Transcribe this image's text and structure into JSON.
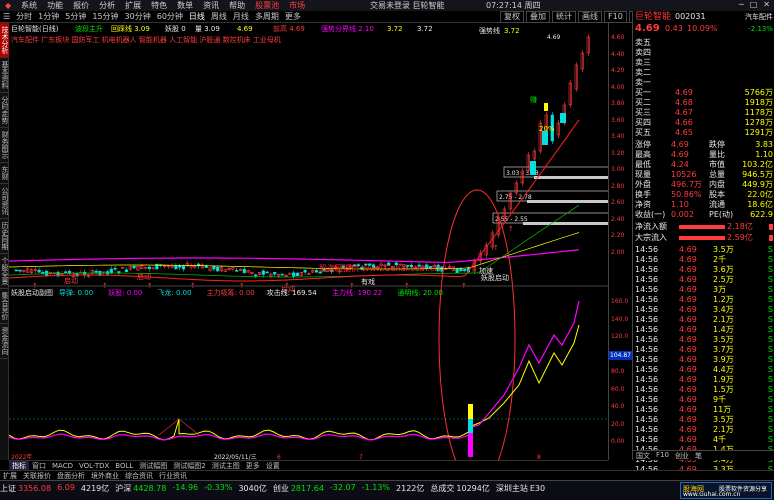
{
  "menubar": {
    "items": [
      "系统",
      "功能",
      "报价",
      "分析",
      "扩展",
      "特色",
      "数单",
      "资讯",
      "帮助"
    ],
    "highlight": [
      "股票池",
      "市场"
    ],
    "center": "交易未登录  巨轮智能",
    "time": "07:27:14 周四"
  },
  "toolbar": {
    "periods": [
      "分时",
      "1分钟",
      "5分钟",
      "15分钟",
      "30分钟",
      "60分钟",
      "日线",
      "周线",
      "月线",
      "多周期",
      "更多"
    ],
    "selected": "日线",
    "right": [
      "复权",
      "叠加",
      "统计",
      "画线",
      "F10",
      "标记",
      "自选"
    ]
  },
  "sidebar": {
    "items": [
      "技术分析",
      "基本资料",
      "分时走势",
      "财务图示",
      "东财",
      "公司资讯",
      "历史同期",
      "个股全景",
      "集合竞价",
      "资金流向"
    ],
    "active": "技术分析"
  },
  "chart": {
    "header_left": "巨轮智能(日线)",
    "header_fields": [
      {
        "label": "波段主升",
        "value": "",
        "color": "#00e000"
      },
      {
        "label": "回踩线",
        "value": "3.09",
        "color": "#ffff00"
      },
      {
        "label": "妖股",
        "value": "0",
        "color": "#e8e8e8"
      },
      {
        "label": "量",
        "value": "3.09",
        "color": "#e8e8e8"
      },
      {
        "label": "4.69",
        "value": "",
        "color": "#ffff00"
      },
      {
        "label": "前高",
        "value": "4.69",
        "color": "#ff3c3c"
      },
      {
        "label": "强势分界线",
        "value": "2.10",
        "color": "#ff00ff"
      },
      {
        "label": "",
        "value": "3.72",
        "color": "#ffff00"
      },
      {
        "label": "",
        "value": "3.72",
        "color": "#e8e8e8"
      }
    ],
    "concept_line": "汽车配件 广东板块 国防军工 机电机器人 智能机器 人工智能 沪股通 数控机床 工业母机",
    "sub_title": "妖股启动主图",
    "main_price_labels": [
      "4.69",
      "3.03 - 3.08",
      "2.75 - 2.78",
      "2.55 - 2.55"
    ],
    "qiangshi_label": "强势线",
    "qiangshi_value": "3.72",
    "annotations": [
      {
        "text": "启动",
        "color": "#ff3c3c"
      },
      {
        "text": "启动",
        "color": "#ff3c3c"
      },
      {
        "text": "启动",
        "color": "#ff3c3c"
      },
      {
        "text": "有戏",
        "color": "#e8e8e8"
      },
      {
        "text": "加速",
        "color": "#e8e8e8"
      },
      {
        "text": "妖股启动",
        "color": "#e8e8e8"
      },
      {
        "text": "赚",
        "color": "#00e000"
      },
      {
        "text": "20%",
        "color": "#ffff00"
      }
    ],
    "watermark_text": "股海网提供 Www.Guhai.com.cn",
    "bottom_axis_ticks": [
      "2022年",
      "2022/05/11/三",
      "6",
      "7",
      "8"
    ],
    "indicator_title": "妖股启动副图",
    "indicator_fields": [
      {
        "label": "导弹",
        "value": "0.00",
        "color": "#00e0e0"
      },
      {
        "label": "妖股",
        "value": "0.00",
        "color": "#ff00ff"
      },
      {
        "label": "飞龙",
        "value": "0.00",
        "color": "#00e0e0"
      },
      {
        "label": "主力吸筹",
        "value": "0.00",
        "color": "#ff3c3c"
      },
      {
        "label": "攻击线",
        "value": "169.54",
        "color": "#e8e8e8"
      },
      {
        "label": "主力线",
        "value": "190.22",
        "color": "#ff00ff"
      },
      {
        "label": "通明线",
        "value": "20.00",
        "color": "#00e000"
      }
    ],
    "indicator_axis": [
      "160.0",
      "140.0",
      "120.0",
      "100.0",
      "80.0",
      "60.0",
      "40.0",
      "20.0",
      "0.00"
    ],
    "indicator_current": "104.87",
    "price_axis": [
      "4.60",
      "4.40",
      "4.20",
      "4.00",
      "3.80",
      "3.60",
      "3.40",
      "3.20",
      "3.00",
      "2.80",
      "2.60",
      "2.40",
      "2.20",
      "2.00"
    ],
    "left_vertical_label": "前复权"
  },
  "quote": {
    "name": "巨轮智能",
    "code": "002031",
    "tag": "汽车配件",
    "price": "4.69",
    "change": "0.43",
    "pct": "10.09%",
    "pct2": "-2.13%",
    "asks": [
      {
        "label": "卖五",
        "price": "",
        "vol": ""
      },
      {
        "label": "卖四",
        "price": "",
        "vol": ""
      },
      {
        "label": "卖三",
        "price": "",
        "vol": ""
      },
      {
        "label": "卖二",
        "price": "",
        "vol": ""
      },
      {
        "label": "卖一",
        "price": "",
        "vol": ""
      }
    ],
    "bids": [
      {
        "label": "买一",
        "price": "4.69",
        "vol": "5766万"
      },
      {
        "label": "买二",
        "price": "4.68",
        "vol": "1918万"
      },
      {
        "label": "买三",
        "price": "4.67",
        "vol": "1178万"
      },
      {
        "label": "买四",
        "price": "4.66",
        "vol": "1278万"
      },
      {
        "label": "买五",
        "price": "4.65",
        "vol": "1291万"
      }
    ],
    "stats": [
      {
        "l1": "涨停",
        "v1": "4.69",
        "l2": "跌停",
        "v2": "3.83"
      },
      {
        "l1": "最高",
        "v1": "4.69",
        "l2": "量比",
        "v2": "1.10"
      },
      {
        "l1": "最低",
        "v1": "4.24",
        "l2": "市值",
        "v2": "103.2亿"
      },
      {
        "l1": "现量",
        "v1": "10526",
        "l2": "总量",
        "v2": "946.5万"
      },
      {
        "l1": "外盘",
        "v1": "496.7万",
        "l2": "内盘",
        "v2": "449.9万"
      },
      {
        "l1": "换手",
        "v1": "50.86%",
        "l2": "股本",
        "v2": "22.0亿"
      },
      {
        "l1": "净资",
        "v1": "1.10",
        "l2": "流通",
        "v2": "18.6亿"
      },
      {
        "l1": "收益(一)",
        "v1": "0.002",
        "l2": "PE(动)",
        "v2": "622.9"
      }
    ],
    "flow": [
      {
        "label": "净流入额",
        "value": "2.18亿"
      },
      {
        "label": "大宗流入",
        "value": "2.59亿"
      }
    ],
    "ticks": [
      {
        "t": "14:56",
        "p": "4.69",
        "v": "3.5万",
        "s": "S"
      },
      {
        "t": "14:56",
        "p": "4.69",
        "v": "2千",
        "s": "S"
      },
      {
        "t": "14:56",
        "p": "4.69",
        "v": "3.6万",
        "s": "S"
      },
      {
        "t": "14:56",
        "p": "4.69",
        "v": "2.5万",
        "s": "S"
      },
      {
        "t": "14:56",
        "p": "4.69",
        "v": "3万",
        "s": "S"
      },
      {
        "t": "14:56",
        "p": "4.69",
        "v": "1.2万",
        "s": "S"
      },
      {
        "t": "14:56",
        "p": "4.69",
        "v": "3.4万",
        "s": "S"
      },
      {
        "t": "14:56",
        "p": "4.69",
        "v": "2.1万",
        "s": "S"
      },
      {
        "t": "14:56",
        "p": "4.69",
        "v": "1.4万",
        "s": "S"
      },
      {
        "t": "14:56",
        "p": "4.69",
        "v": "3.5万",
        "s": "S"
      },
      {
        "t": "14:56",
        "p": "4.69",
        "v": "3.7万",
        "s": "S"
      },
      {
        "t": "14:56",
        "p": "4.69",
        "v": "3.9万",
        "s": "S"
      },
      {
        "t": "14:56",
        "p": "4.69",
        "v": "4.4万",
        "s": "S"
      },
      {
        "t": "14:56",
        "p": "4.69",
        "v": "1.9万",
        "s": "S"
      },
      {
        "t": "14:56",
        "p": "4.69",
        "v": "1.5万",
        "s": "S"
      },
      {
        "t": "14:56",
        "p": "4.69",
        "v": "9千",
        "s": "S"
      },
      {
        "t": "14:56",
        "p": "4.69",
        "v": "11万",
        "s": "S"
      },
      {
        "t": "14:56",
        "p": "4.69",
        "v": "3.5万",
        "s": "S"
      },
      {
        "t": "14:56",
        "p": "4.69",
        "v": "2.1万",
        "s": "S"
      },
      {
        "t": "14:56",
        "p": "4.69",
        "v": "4千",
        "s": "S"
      },
      {
        "t": "14:56",
        "p": "4.69",
        "v": "1.4万",
        "s": "S"
      },
      {
        "t": "14:56",
        "p": "4.69",
        "v": "3.4万",
        "s": "S"
      },
      {
        "t": "14:56",
        "p": "4.69",
        "v": "3.3万",
        "s": "S"
      },
      {
        "t": "14:56",
        "p": "4.69",
        "v": "2.6万",
        "s": "S"
      },
      {
        "t": "15:00",
        "p": "4.69",
        "v": "2.9万",
        "s": "S"
      }
    ],
    "panel_tabs": [
      "国文",
      "F10",
      "创业",
      "笔"
    ]
  },
  "tabs": [
    "指标",
    "窗口",
    "MACD",
    "VOL-TDX",
    "BOLL",
    "测试幅图",
    "测试幅图2",
    "测试主图",
    "更多",
    "设置"
  ],
  "tabs2": [
    "扩展",
    "关联报价",
    "盘面分析",
    "境外商业",
    "综合资讯",
    "行业资讯"
  ],
  "status": {
    "items": [
      {
        "label": "上证",
        "value": "3356.08",
        "color": "#ff3c3c"
      },
      {
        "label": "",
        "value": "6.09",
        "color": "#ff3c3c"
      },
      {
        "label": "",
        "value": "4219亿",
        "color": "#e8e8e8"
      },
      {
        "label": "沪深",
        "value": "4428.78",
        "color": "#00e000"
      },
      {
        "label": "",
        "value": "-14.96",
        "color": "#00e000"
      },
      {
        "label": "",
        "value": "-0.33%",
        "color": "#00e000"
      },
      {
        "label": "",
        "value": "3040亿",
        "color": "#e8e8e8"
      },
      {
        "label": "创业",
        "value": "2817.64",
        "color": "#00e000"
      },
      {
        "label": "",
        "value": "-32.07",
        "color": "#00e000"
      },
      {
        "label": "",
        "value": "-1.13%",
        "color": "#00e000"
      },
      {
        "label": "",
        "value": "2122亿",
        "color": "#e8e8e8"
      },
      {
        "label": "总成交",
        "value": "10294亿",
        "color": "#e8e8e8"
      },
      {
        "label": "深圳主站",
        "value": "E30",
        "color": "#e8e8e8"
      }
    ],
    "watermark": {
      "brand": "股海网",
      "line1": "股票软件资源分享",
      "line2": "www.Guhai.com.cn"
    }
  },
  "colors": {
    "up": "#ff3c3c",
    "down": "#00e000",
    "accent": "#ffff00",
    "magenta": "#ff00ff",
    "cyan": "#00e0e0"
  }
}
